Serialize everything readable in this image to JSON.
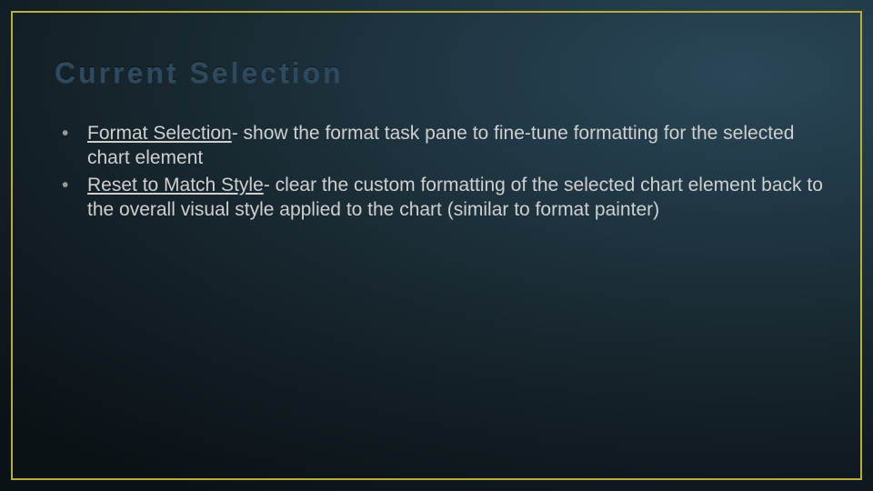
{
  "slide": {
    "title": "Current Selection",
    "items": [
      {
        "term": "Format Selection",
        "desc": "- show the format task pane to fine-tune formatting for the selected chart element"
      },
      {
        "term": "Reset to Match Style",
        "desc": "- clear the custom formatting of the selected chart element back to the overall visual style applied to the chart (similar to format painter)"
      }
    ]
  }
}
